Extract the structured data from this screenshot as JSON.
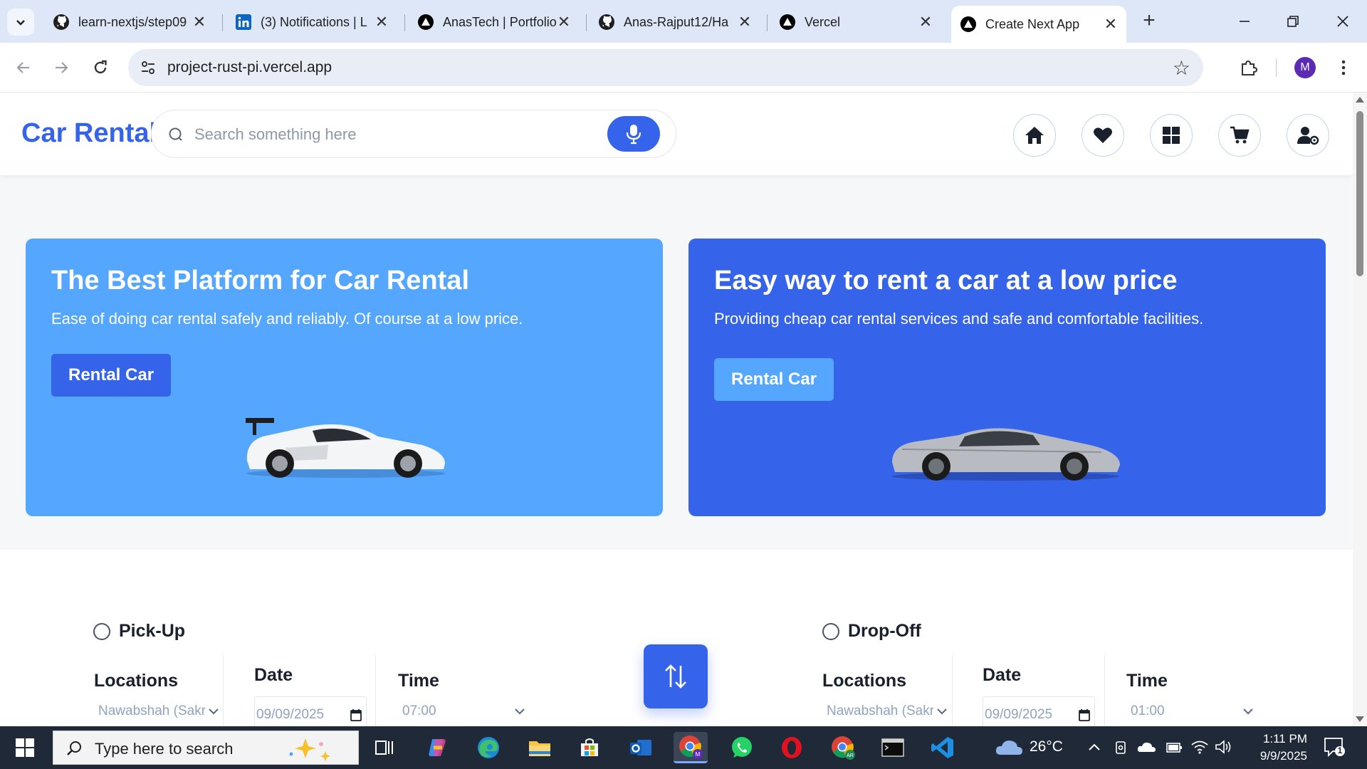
{
  "browser": {
    "tabs": [
      {
        "title": "learn-nextjs/step09",
        "icon": "github-icon"
      },
      {
        "title": "(3) Notifications | L",
        "icon": "linkedin-icon"
      },
      {
        "title": "AnasTech | Portfolio",
        "icon": "vercel-icon"
      },
      {
        "title": "Anas-Rajput12/Ha",
        "icon": "github-icon"
      },
      {
        "title": "Vercel",
        "icon": "vercel-icon"
      },
      {
        "title": "Create Next App",
        "icon": "vercel-icon",
        "active": true
      }
    ],
    "url": "project-rust-pi.vercel.app",
    "profile_initial": "M"
  },
  "site": {
    "logo": "Car Rental",
    "search_placeholder": "Search something here",
    "header_icons": [
      "home-icon",
      "heart-icon",
      "dashboard-icon",
      "cart-icon",
      "user-settings-icon"
    ],
    "promos": [
      {
        "title": "The Best Platform for Car Rental",
        "subtitle": "Ease of doing car rental safely and reliably. Of course at a low price.",
        "button": "Rental Car",
        "bg": "#54a6ff",
        "button_bg": "#3563e9",
        "car_color": "#f4f5f7"
      },
      {
        "title": "Easy way to rent a car at a low price",
        "subtitle": "Providing cheap car rental services and safe and comfortable facilities.",
        "button": "Rental Car",
        "bg": "#3563e9",
        "button_bg": "#54a6ff",
        "car_color": "#b8bcc2"
      }
    ],
    "pickup": {
      "label": "Pick-Up",
      "locations_label": "Locations",
      "location_value": "Nawabshah (Sakrand)",
      "date_label": "Date",
      "date_value": "09/09/2025",
      "time_label": "Time",
      "time_value": "07:00"
    },
    "dropoff": {
      "label": "Drop-Off",
      "locations_label": "Locations",
      "location_value": "Nawabshah (Sakrand)",
      "date_label": "Date",
      "date_value": "09/09/2025",
      "time_label": "Time",
      "time_value": "01:00"
    }
  },
  "taskbar": {
    "search_placeholder": "Type here to search",
    "temperature": "26°C",
    "time": "1:11 PM",
    "date": "9/9/2025",
    "notification_count": "1"
  },
  "colors": {
    "brand": "#3563e9",
    "light_blue": "#54a6ff"
  }
}
